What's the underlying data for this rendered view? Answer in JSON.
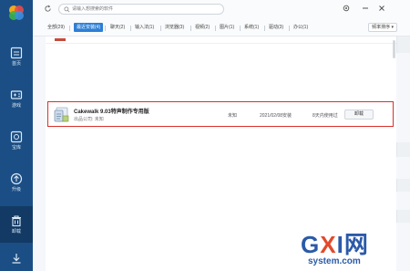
{
  "sidebar": {
    "items": [
      {
        "label": "首页",
        "icon": "home-icon"
      },
      {
        "label": "游戏",
        "icon": "gamepad-icon"
      },
      {
        "label": "宝库",
        "icon": "treasure-icon"
      },
      {
        "label": "升级",
        "icon": "upgrade-icon"
      },
      {
        "label": "卸载",
        "icon": "trash-icon"
      },
      {
        "label": "",
        "icon": "download-icon"
      }
    ],
    "active": "卸载"
  },
  "search": {
    "placeholder": "请输入想搜索的软件"
  },
  "window_controls": [
    "settings-icon",
    "minimize-icon",
    "close-icon"
  ],
  "tabs": [
    {
      "label": "全部(29)"
    },
    {
      "label": "最近安装(4)",
      "active": true
    },
    {
      "label": "聊天(2)"
    },
    {
      "label": "输入法(1)"
    },
    {
      "label": "浏览器(3)"
    },
    {
      "label": "视频(2)"
    },
    {
      "label": "图片(1)"
    },
    {
      "label": "系统(1)"
    },
    {
      "label": "驱动(3)"
    },
    {
      "label": "办公(1)"
    }
  ],
  "sort_button": "频率排序 ▾",
  "app_row": {
    "name": "Cakewalk 9.03特声制作专用版",
    "company": "出品公司: 未知",
    "size": "未知",
    "install_date": "2021/02/08安装",
    "usage": "8天内使用过",
    "uninstall_label": "卸载"
  },
  "watermark": {
    "brand_g": "G",
    "brand_x": "X",
    "brand_i": "I",
    "brand_net": "网",
    "domain": "system.com"
  },
  "colors": {
    "sidebar": "#1b4e84",
    "sidebar_active": "#123a64",
    "tab_active": "#2d7fd6",
    "highlight_border": "#d9302c"
  }
}
